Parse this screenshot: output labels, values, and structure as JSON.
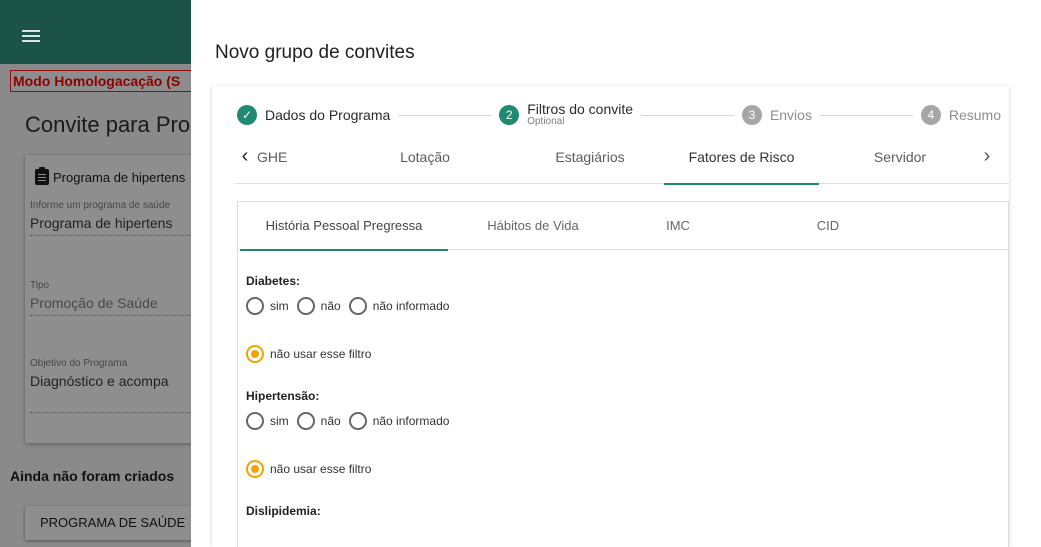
{
  "background": {
    "homolog_banner": "Modo Homologacação (S",
    "page_title": "Convite para Pro",
    "card_title": "Programa de hipertens",
    "fields": [
      {
        "label": "Informe um programa de saúde",
        "value": "Programa de hipertens"
      },
      {
        "label": "Tipo",
        "value": "Promoção de Saúde"
      },
      {
        "label": "Objetivo do Programa",
        "value": "Diagnóstico e acompa"
      }
    ],
    "footer_text": "Ainda não foram criados",
    "program_button": "PROGRAMA DE SAÚDE"
  },
  "dialog": {
    "title": "Novo grupo de convites",
    "steps": [
      {
        "label": "Dados do Programa",
        "marker": "✓",
        "state": "done"
      },
      {
        "label": "Filtros do convite",
        "sublabel": "Optional",
        "marker": "2",
        "state": "active"
      },
      {
        "label": "Envios",
        "marker": "3",
        "state": "todo"
      },
      {
        "label": "Resumo",
        "marker": "4",
        "state": "todo"
      }
    ],
    "top_tabs": [
      "GHE",
      "Lotação",
      "Estagiários",
      "Fatores de Risco",
      "Servidor"
    ],
    "active_top_tab": "Fatores de Risco",
    "inner_tabs": [
      "História Pessoal Pregressa",
      "Hábitos de Vida",
      "IMC",
      "CID"
    ],
    "active_inner_tab": "História Pessoal Pregressa",
    "filters": [
      {
        "title": "Diabetes:",
        "options": [
          "sim",
          "não",
          "não informado"
        ],
        "ignore_label": "não usar esse filtro"
      },
      {
        "title": "Hipertensão:",
        "options": [
          "sim",
          "não",
          "não informado"
        ],
        "ignore_label": "não usar esse filtro"
      },
      {
        "title": "Dislipidemia:"
      }
    ]
  },
  "colors": {
    "accent": "#1f8a6f",
    "radio_selected": "#f1a400",
    "topbar": "#1b5346",
    "warning": "#8f0000"
  }
}
